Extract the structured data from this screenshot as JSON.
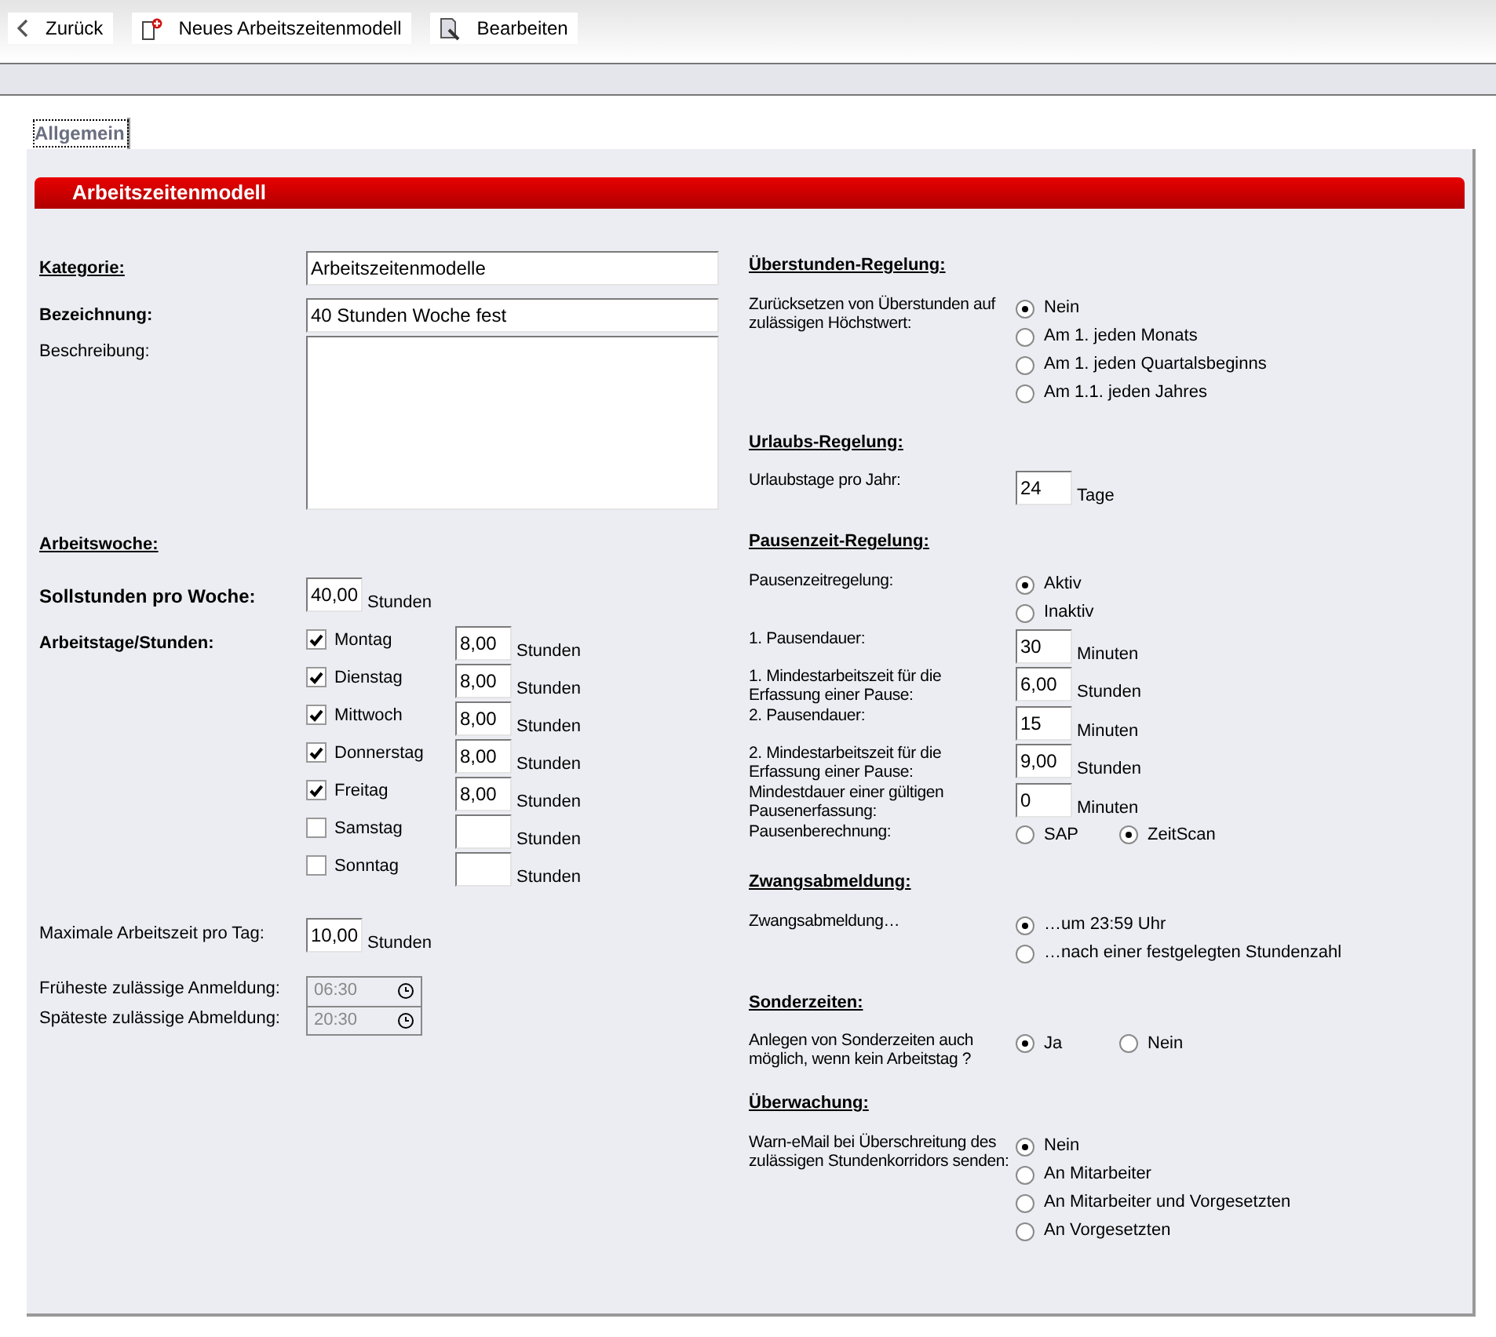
{
  "toolbar": [
    {
      "label": "Zurück",
      "kind": "back"
    },
    {
      "label": "Neues Arbeitszeitenmodell",
      "kind": "new"
    },
    {
      "label": "Bearbeiten",
      "kind": "edit"
    }
  ],
  "tabs": [
    {
      "label": "Allgemein",
      "selected": true
    }
  ],
  "section_title": "Arbeitszeitenmodell",
  "general": {
    "kategorie": {
      "label": "Kategorie:",
      "value": "Arbeitszeitenmodelle"
    },
    "bezeichnung": {
      "label": "Bezeichnung:",
      "value": "40 Stunden Woche fest"
    },
    "beschreibung": {
      "label": "Beschreibung:"
    }
  },
  "arbeitswoche": {
    "heading": "Arbeitswoche:",
    "sollstunden": {
      "label": "Sollstunden pro Woche:",
      "value": "40,00",
      "unit": "Stunden"
    },
    "arbeitstage": {
      "label": "Arbeitstage/Stunden:",
      "days": [
        {
          "name": "Montag",
          "checked": true,
          "hours": "8,00",
          "unit": "Stunden"
        },
        {
          "name": "Dienstag",
          "checked": true,
          "hours": "8,00",
          "unit": "Stunden"
        },
        {
          "name": "Mittwoch",
          "checked": true,
          "hours": "8,00",
          "unit": "Stunden"
        },
        {
          "name": "Donnerstag",
          "checked": true,
          "hours": "8,00",
          "unit": "Stunden"
        },
        {
          "name": "Freitag",
          "checked": true,
          "hours": "8,00",
          "unit": "Stunden"
        },
        {
          "name": "Samstag",
          "checked": false,
          "unit": "Stunden"
        },
        {
          "name": "Sonntag",
          "checked": false,
          "unit": "Stunden"
        }
      ]
    },
    "max": {
      "label": "Maximale Arbeitszeit pro Tag:",
      "value": "10,00",
      "unit": "Stunden"
    },
    "times": [
      {
        "label": "Früheste zulässige Anmeldung:",
        "value": "06:30",
        "disabled": true
      },
      {
        "label": "Späteste zulässige Abmeldung:",
        "value": "20:30",
        "disabled": true
      }
    ]
  },
  "sections": [
    {
      "heading": "Überstunden-Regelung:",
      "rows": [
        {
          "kind": "radio",
          "label": "Zurücksetzen von Überstunden auf zulässigen Höchstwert:",
          "options": [
            {
              "label": "Nein",
              "selected": true
            },
            {
              "label": "Am 1. jeden Monats",
              "selected": false
            },
            {
              "label": "Am 1. jeden Quartalsbeginns",
              "selected": false
            },
            {
              "label": "Am 1.1. jeden Jahres",
              "selected": false
            }
          ]
        }
      ]
    },
    {
      "heading": "Urlaubs-Regelung:",
      "rows": [
        {
          "kind": "input",
          "label": "Urlaubstage pro Jahr:",
          "value": "24",
          "unit": "Tage"
        }
      ]
    },
    {
      "heading": "Pausenzeit-Regelung:",
      "rows": [
        {
          "kind": "radio",
          "label": "Pausenzeitregelung:",
          "options": [
            {
              "label": "Aktiv",
              "selected": true
            },
            {
              "label": "Inaktiv",
              "selected": false
            }
          ]
        },
        {
          "kind": "input",
          "label": "1. Pausendauer:",
          "value": "30",
          "unit": "Minuten"
        },
        {
          "kind": "input",
          "label": "1. Mindestarbeitszeit für die Erfassung einer Pause:",
          "value": "6,00",
          "unit": "Stunden"
        },
        {
          "kind": "input",
          "label": "2. Pausendauer:",
          "value": "15",
          "unit": "Minuten"
        },
        {
          "kind": "input",
          "label": "2. Mindestarbeitszeit für die Erfassung einer Pause:",
          "value": "9,00",
          "unit": "Stunden"
        },
        {
          "kind": "input",
          "label": "Mindestdauer einer gültigen Pausenerfassung:",
          "value": "0",
          "unit": "Minuten"
        },
        {
          "kind": "radio_inline",
          "label": "Pausenberechnung:",
          "options": [
            {
              "label": "SAP",
              "selected": false
            },
            {
              "label": "ZeitScan",
              "selected": true
            }
          ]
        }
      ]
    },
    {
      "heading": "Zwangsabmeldung:",
      "rows": [
        {
          "kind": "radio",
          "label": "Zwangsabmeldung…",
          "options": [
            {
              "label": "…um 23:59 Uhr",
              "selected": true
            },
            {
              "label": "…nach einer festgelegten Stundenzahl",
              "selected": false
            }
          ]
        }
      ]
    },
    {
      "heading": "Sonderzeiten:",
      "rows": [
        {
          "kind": "radio_inline",
          "label": "Anlegen von Sonderzeiten auch möglich, wenn kein Arbeitstag ?",
          "options": [
            {
              "label": "Ja",
              "selected": true
            },
            {
              "label": "Nein",
              "selected": false
            }
          ]
        }
      ]
    },
    {
      "heading": "Überwachung:",
      "rows": [
        {
          "kind": "radio",
          "label": "Warn-eMail bei Überschreitung des zulässigen Stundenkorridors senden:",
          "options": [
            {
              "label": "Nein",
              "selected": true
            },
            {
              "label": "An Mitarbeiter",
              "selected": false
            },
            {
              "label": "An Mitarbeiter und Vorgesetzten",
              "selected": false
            },
            {
              "label": "An Vorgesetzten",
              "selected": false
            }
          ]
        }
      ]
    }
  ]
}
